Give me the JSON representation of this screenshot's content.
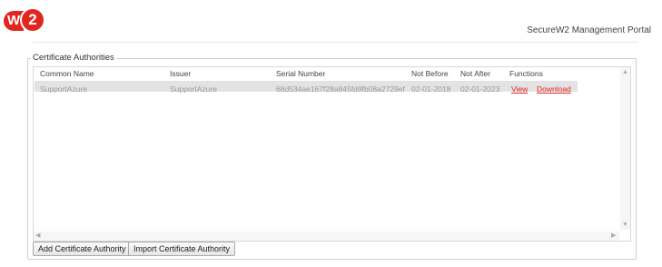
{
  "brand": {
    "logo_w": "W",
    "logo_2": "2",
    "accent": "#e0261f"
  },
  "header": {
    "portal_title": "SecureW2 Management Portal"
  },
  "section": {
    "legend": "Certificate Authorities"
  },
  "table": {
    "columns": [
      "Common Name",
      "Issuer",
      "Serial Number",
      "Not Before",
      "Not After",
      "Functions"
    ],
    "rows": [
      {
        "common_name": "SupportAzure",
        "issuer": "SupportAzure",
        "serial_number": "68d534ae167f28a845fd9fb08a2729ef",
        "not_before": "02-01-2018",
        "not_after": "02-01-2023",
        "view_label": "View",
        "download_label": "Download"
      }
    ],
    "scroll_icons": [
      "scroll-up-icon",
      "scroll-down-icon",
      "scroll-left-icon",
      "scroll-right-icon"
    ]
  },
  "buttons": {
    "add": "Add Certificate Authority",
    "import": "Import Certificate Authority"
  }
}
